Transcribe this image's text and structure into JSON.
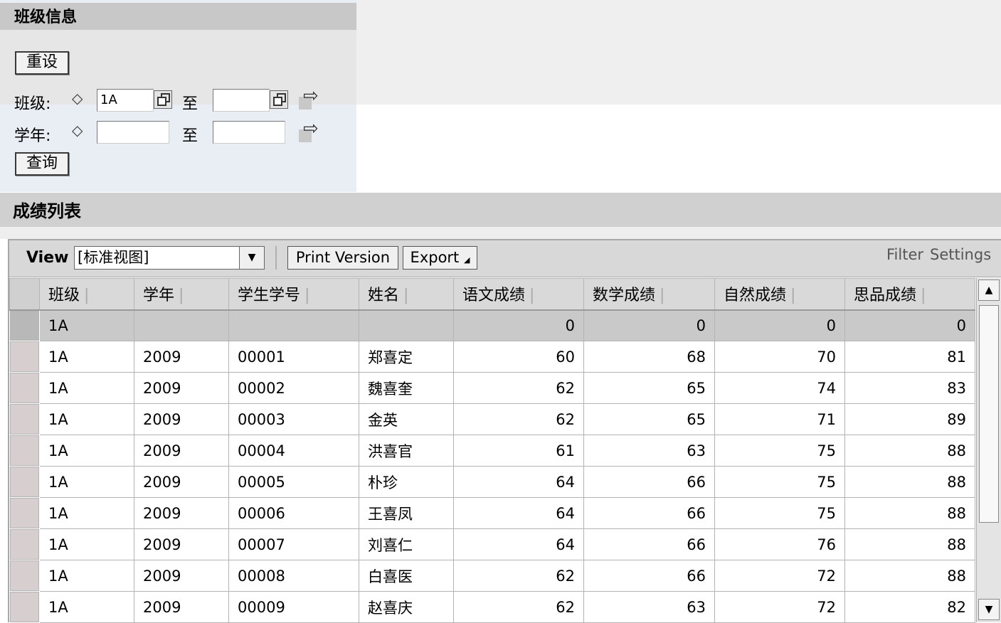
{
  "class_info": {
    "title": "班级信息",
    "reset_label": "重设",
    "class_label": "班级:",
    "year_label": "学年:",
    "to_label": "至",
    "class_from_value": "1A",
    "class_to_value": "",
    "year_from_value": "",
    "year_to_value": "",
    "query_label": "查询",
    "diamond_glyph": "◇",
    "arrow_glyph": "⇨"
  },
  "grades": {
    "title": "成绩列表",
    "toolbar": {
      "view_label": "View",
      "view_selected": "[标准视图]",
      "print_label": "Print Version",
      "export_label": "Export",
      "export_glyph": "◢",
      "filter_label": "Filter",
      "settings_label": "Settings"
    },
    "columns": [
      "班级",
      "学年",
      "学生学号",
      "姓名",
      "语文成绩",
      "数学成绩",
      "自然成绩",
      "思品成绩"
    ],
    "summary_row": {
      "class": "1A",
      "year": "",
      "id": "",
      "name": "",
      "chinese": "0",
      "math": "0",
      "science": "0",
      "ethics": "0"
    },
    "rows": [
      {
        "class": "1A",
        "year": "2009",
        "id": "00001",
        "name": "郑喜定",
        "chinese": "60",
        "math": "68",
        "science": "70",
        "ethics": "81"
      },
      {
        "class": "1A",
        "year": "2009",
        "id": "00002",
        "name": "魏喜奎",
        "chinese": "62",
        "math": "65",
        "science": "74",
        "ethics": "83"
      },
      {
        "class": "1A",
        "year": "2009",
        "id": "00003",
        "name": "金英",
        "chinese": "62",
        "math": "65",
        "science": "71",
        "ethics": "89"
      },
      {
        "class": "1A",
        "year": "2009",
        "id": "00004",
        "name": "洪喜官",
        "chinese": "61",
        "math": "63",
        "science": "75",
        "ethics": "88"
      },
      {
        "class": "1A",
        "year": "2009",
        "id": "00005",
        "name": "朴珍",
        "chinese": "64",
        "math": "66",
        "science": "75",
        "ethics": "88"
      },
      {
        "class": "1A",
        "year": "2009",
        "id": "00006",
        "name": "王喜凤",
        "chinese": "64",
        "math": "66",
        "science": "75",
        "ethics": "88"
      },
      {
        "class": "1A",
        "year": "2009",
        "id": "00007",
        "name": "刘喜仁",
        "chinese": "64",
        "math": "66",
        "science": "76",
        "ethics": "88"
      },
      {
        "class": "1A",
        "year": "2009",
        "id": "00008",
        "name": "白喜医",
        "chinese": "62",
        "math": "66",
        "science": "72",
        "ethics": "88"
      },
      {
        "class": "1A",
        "year": "2009",
        "id": "00009",
        "name": "赵喜庆",
        "chinese": "62",
        "math": "63",
        "science": "72",
        "ethics": "82"
      }
    ],
    "scroll_up_glyph": "▲",
    "scroll_down_glyph": "▼"
  }
}
